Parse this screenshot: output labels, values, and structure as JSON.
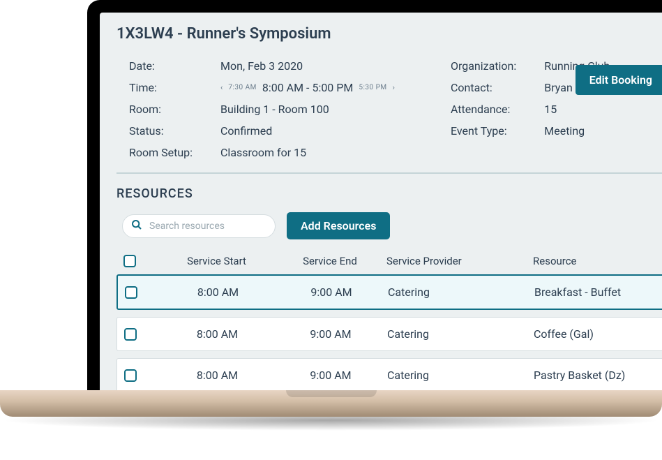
{
  "booking": {
    "title": "1X3LW4 - Runner's Symposium",
    "labels": {
      "date": "Date:",
      "time": "Time:",
      "room": "Room:",
      "status": "Status:",
      "room_setup": "Room Setup:",
      "organization": "Organization:",
      "contact": "Contact:",
      "attendance": "Attendance:",
      "event_type": "Event Type:"
    },
    "values": {
      "date": "Mon, Feb 3 2020",
      "time_pre": "7:30 AM",
      "time_main": "8:00 AM - 5:00 PM",
      "time_post": "5:30 PM",
      "room": "Building 1 - Room 100",
      "status": "Confirmed",
      "room_setup": "Classroom for 15",
      "organization": "Running Club",
      "contact": "Bryan Peck",
      "attendance": "15",
      "event_type": "Meeting"
    },
    "edit_label": "Edit Booking"
  },
  "resources": {
    "section_title": "RESOURCES",
    "search_placeholder": "Search resources",
    "add_label": "Add Resources",
    "columns": {
      "service_start": "Service Start",
      "service_end": "Service End",
      "service_provider": "Service Provider",
      "resource": "Resource"
    },
    "rows": [
      {
        "start": "8:00 AM",
        "end": "9:00 AM",
        "provider": "Catering",
        "resource": "Breakfast - Buffet"
      },
      {
        "start": "8:00 AM",
        "end": "9:00 AM",
        "provider": "Catering",
        "resource": "Coffee (Gal)"
      },
      {
        "start": "8:00 AM",
        "end": "9:00 AM",
        "provider": "Catering",
        "resource": "Pastry Basket (Dz)"
      }
    ]
  }
}
